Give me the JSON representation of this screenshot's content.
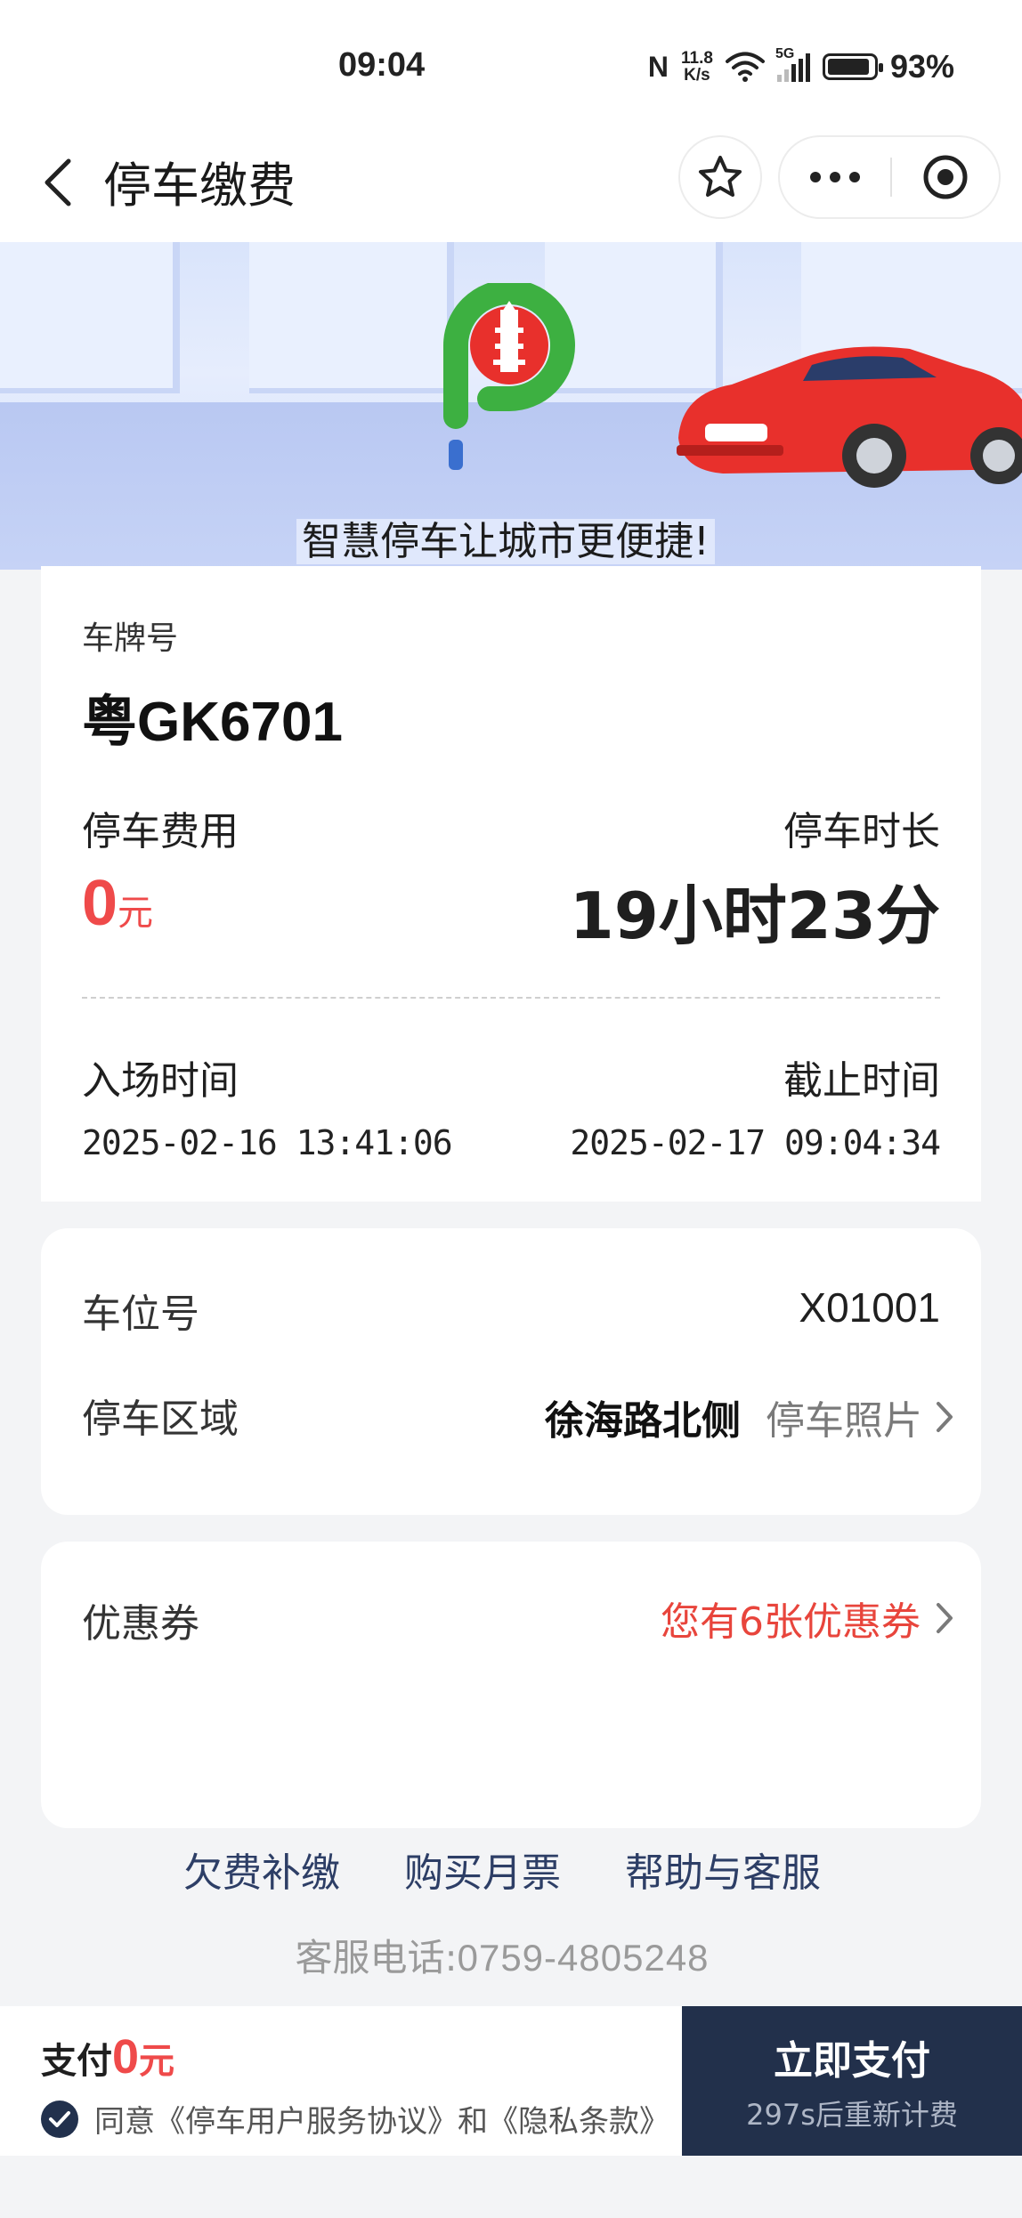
{
  "status_bar": {
    "time": "09:04",
    "nfc": "N",
    "speed_value": "11.8",
    "speed_unit": "K/s",
    "network": "5G",
    "battery_level": 0.93,
    "battery_text": "93%"
  },
  "nav": {
    "title": "停车缴费",
    "icons": [
      "back-arrow",
      "star",
      "more-dots",
      "close-target"
    ]
  },
  "banner": {
    "slogan": "智慧停车让城市更便捷!",
    "colors": {
      "logo_green": "#3db041",
      "car_red": "#e8302c"
    }
  },
  "parking": {
    "plate_label": "车牌号",
    "plate": "粤GK6701",
    "fee_label": "停车费用",
    "fee_value": "0",
    "fee_unit": "元",
    "duration_label": "停车时长",
    "duration": "19小时23分",
    "entry_label": "入场时间",
    "entry_time": "2025-02-16 13:41:06",
    "cutoff_label": "截止时间",
    "cutoff_time": "2025-02-17 09:04:34"
  },
  "spot": {
    "number_label": "车位号",
    "number": "X01001",
    "area_label": "停车区域",
    "area": "徐海路北侧",
    "photo_link": "停车照片"
  },
  "coupon": {
    "label": "优惠券",
    "link": "您有6张优惠券"
  },
  "footer": {
    "links": [
      "欠费补缴",
      "购买月票",
      "帮助与客服"
    ],
    "phone_label": "客服电话:",
    "phone": "0759-4805248"
  },
  "pay": {
    "amount_label": "支付",
    "amount": "0",
    "unit": "元",
    "agreement": "同意《停车用户服务协议》和《隐私条款》",
    "button": "立即支付",
    "button_sub": "297s后重新计费"
  },
  "colors": {
    "accent_red": "#ef4a4a",
    "navy": "#22304b",
    "link_navy": "#2d3e66"
  }
}
